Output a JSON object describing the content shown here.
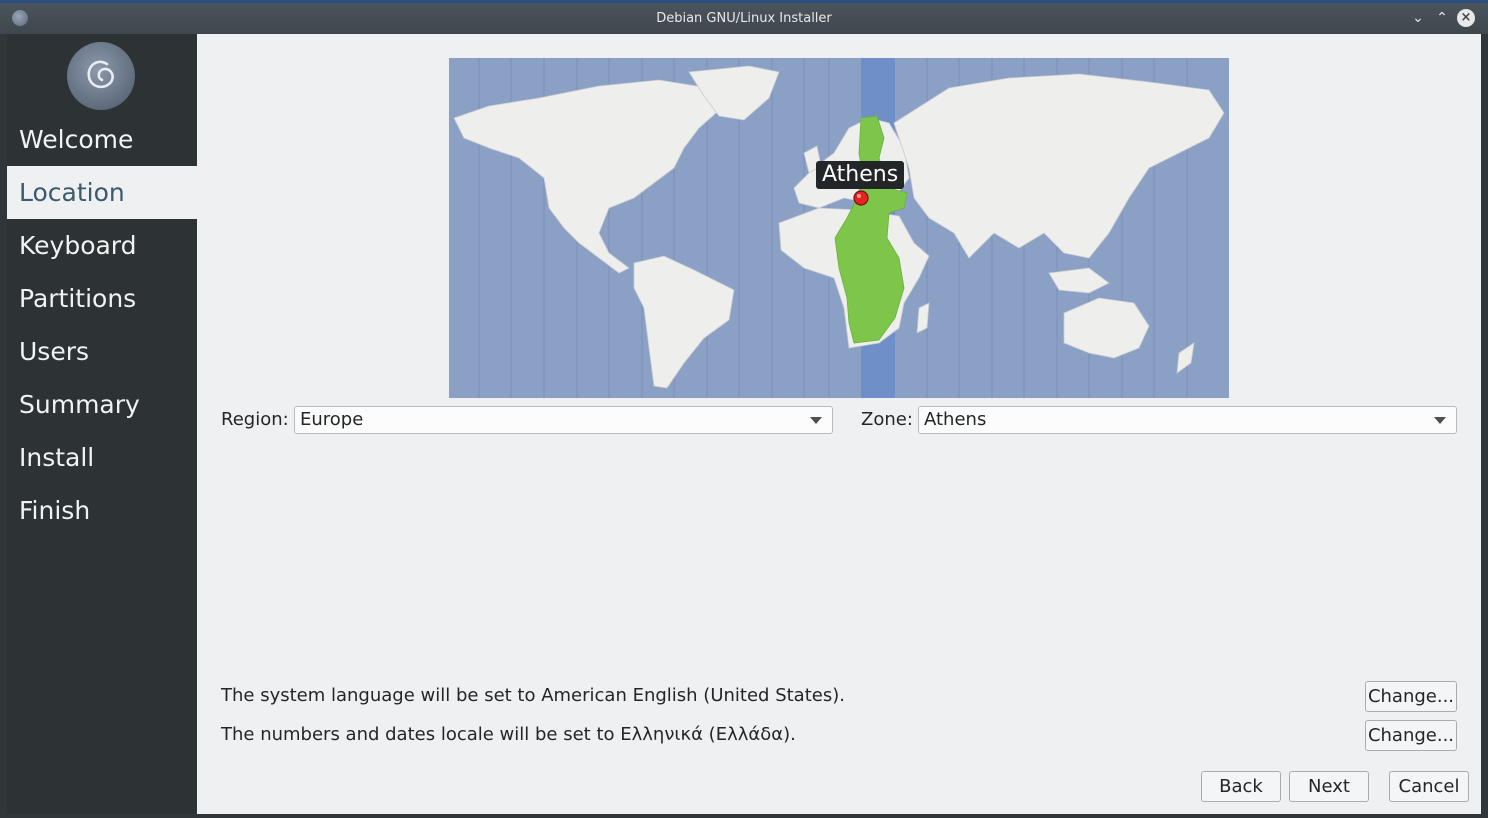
{
  "window": {
    "title": "Debian GNU/Linux Installer"
  },
  "sidebar": {
    "items": [
      {
        "label": "Welcome",
        "active": false
      },
      {
        "label": "Location",
        "active": true
      },
      {
        "label": "Keyboard",
        "active": false
      },
      {
        "label": "Partitions",
        "active": false
      },
      {
        "label": "Users",
        "active": false
      },
      {
        "label": "Summary",
        "active": false
      },
      {
        "label": "Install",
        "active": false
      },
      {
        "label": "Finish",
        "active": false
      }
    ]
  },
  "map": {
    "selected_city": "Athens",
    "highlight_color": "#7dc64a",
    "ocean_color": "#8ba0c5"
  },
  "region": {
    "label": "Region:",
    "value": "Europe"
  },
  "zone": {
    "label": "Zone:",
    "value": "Athens"
  },
  "language": {
    "text": "The system language will be set to American English (United States).",
    "button": "Change..."
  },
  "locale": {
    "text": "The numbers and dates locale will be set to Ελληνικά (Ελλάδα).",
    "button": "Change..."
  },
  "buttons": {
    "back": "Back",
    "next": "Next",
    "cancel": "Cancel"
  },
  "colors": {
    "sidebar_bg": "#2d3235",
    "content_bg": "#eff0f1",
    "active_text": "#3b5a6e"
  }
}
